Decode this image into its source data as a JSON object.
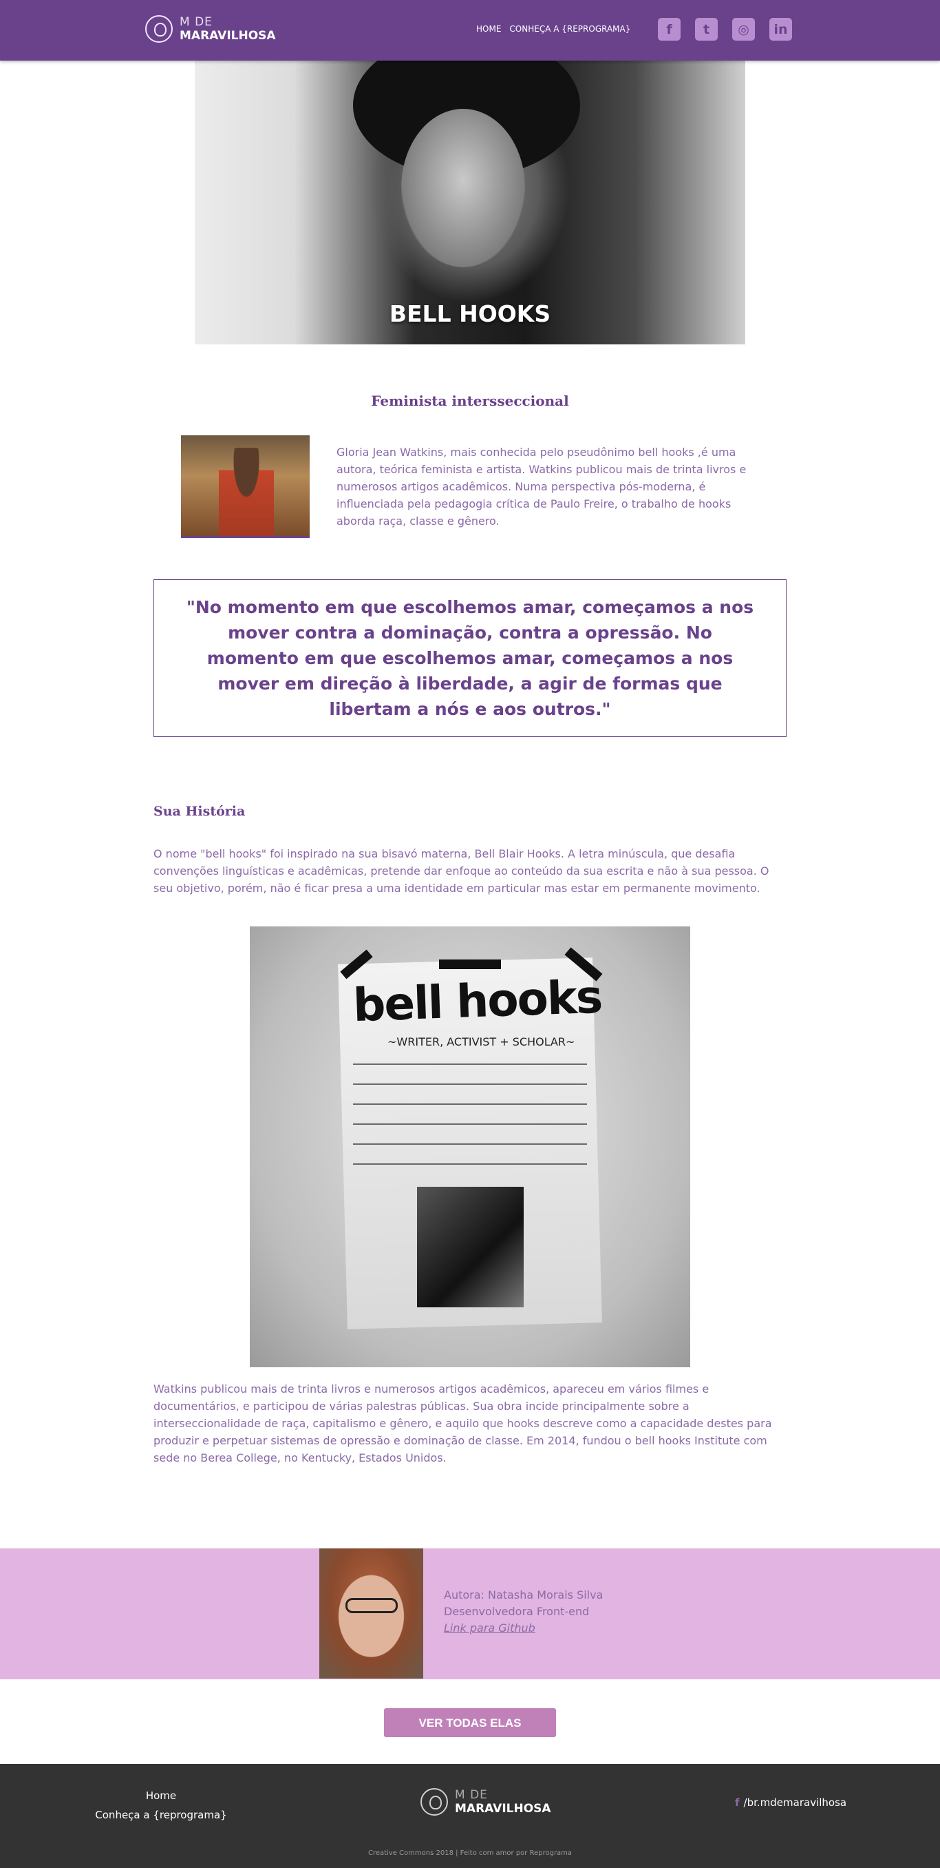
{
  "header": {
    "logo_line1": "M DE",
    "logo_line2": "MARAVILHOSA",
    "nav": [
      "HOME",
      "CONHEÇA A {REPROGRAMA}"
    ],
    "social_icons": [
      "facebook-icon",
      "twitter-icon",
      "instagram-icon",
      "linkedin-icon"
    ]
  },
  "hero": {
    "title": "BELL HOOKS"
  },
  "intro": {
    "subtitle": "Feminista intersseccional",
    "text": "Gloria Jean Watkins, mais conhecida pelo pseudônimo bell hooks ,é uma autora, teórica feminista e artista. Watkins publicou mais de trinta livros e numerosos artigos acadêmicos. Numa perspectiva pós-moderna, é influenciada pela pedagogia crítica de Paulo Freire, o trabalho de hooks aborda raça, classe e gênero."
  },
  "quote": "\"No momento em que escolhemos amar, começamos a nos mover contra a dominação, contra a opressão. No momento em que escolhemos amar, começamos a nos mover em direção à liberdade, a agir de formas que libertam a nós e aos outros.\"",
  "history": {
    "title": "Sua História",
    "p1": "O nome \"bell hooks\" foi inspirado na sua bisavó materna, Bell Blair Hooks. A letra minúscula, que desafia convenções linguísticas e acadêmicas, pretende dar enfoque ao conteúdo da sua escrita e não à sua pessoa. O seu objetivo, porém, não é ficar presa a uma identidade em particular mas estar em permanente movimento.",
    "poster_title": "bell hooks",
    "poster_subtitle": "~WRITER, ACTIVIST + SCHOLAR~",
    "p2": "Watkins publicou mais de trinta livros e numerosos artigos acadêmicos, apareceu em vários filmes e documentários, e participou de várias palestras públicas. Sua obra incide principalmente sobre a interseccionalidade de raça, capitalismo e gênero, e aquilo que hooks descreve como a capacidade destes para produzir e perpetuar sistemas de opressão e dominação de classe. Em 2014, fundou o bell hooks Institute com sede no Berea College, no Kentucky, Estados Unidos."
  },
  "author": {
    "name": "Autora: Natasha Morais Silva",
    "role": "Desenvolvedora Front-end",
    "link": "Link para Github"
  },
  "cta": {
    "label": "VER TODAS ELAS"
  },
  "footer": {
    "links": [
      "Home",
      "Conheça a {reprograma}"
    ],
    "logo_line1": "M DE",
    "logo_line2": "MARAVILHOSA",
    "social_glyph": "f",
    "social": "/br.mdemaravilhosa",
    "copyright": "Creative Commons 2018 | Feito com amor por Reprograma"
  }
}
